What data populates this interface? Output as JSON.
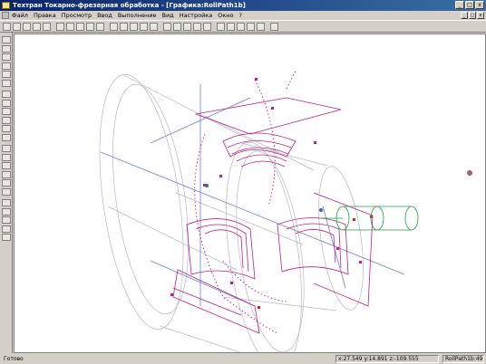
{
  "window": {
    "title": "Техтран  Токарно-фрезерная обработка - [Графика:RollPath1b]",
    "min_label": "_",
    "max_label": "□",
    "close_label": "x"
  },
  "menu": {
    "items": [
      "Файл",
      "Правка",
      "Просмотр",
      "Ввод",
      "Выполнение",
      "Вид",
      "Настройка",
      "Окно",
      "?"
    ]
  },
  "toolbar": {
    "buttons": [
      "new-icon",
      "open-icon",
      "save-icon",
      "print-icon",
      "cut-icon",
      "copy-icon",
      "paste-icon",
      "zoom-in-icon",
      "zoom-out-icon",
      "zoom-window-icon",
      "zoom-all-icon",
      "view-front-icon",
      "view-top-icon",
      "view-side-icon",
      "view-iso-icon",
      "tool-path-icon",
      "line-icon",
      "arc-icon",
      "point-icon",
      "rotate-icon",
      "pan-icon",
      "shade-icon",
      "wire-icon",
      "hide-icon",
      "grid-icon",
      "snap-icon"
    ]
  },
  "left_toolbar": {
    "buttons": [
      "point-icon",
      "line-icon",
      "circle-icon",
      "contour-icon",
      "rectangle-icon",
      "offset-icon",
      "fillet-icon",
      "chamfer-icon",
      "trim-icon",
      "delete-icon",
      "layer-icon",
      "attribute-icon",
      "measure-icon",
      "section-icon",
      "surface-icon",
      "solid-icon",
      "tool-icon",
      "machine-icon",
      "cycle-icon",
      "simulate-icon",
      "verify-icon",
      "undo-icon",
      "redo-icon"
    ]
  },
  "status": {
    "ready": "Готово",
    "coords": "x:27.549 y:14.891 z:-109.555",
    "object": "RollPath1b:49"
  },
  "colors": {
    "titlebar": "#0a246a",
    "background": "#d4d0c8",
    "viewport": "#ffffff",
    "part_wire": "#b0b0b0",
    "axis": "#5070d0",
    "toolpath": "#c02080",
    "tool": "#20a040"
  }
}
